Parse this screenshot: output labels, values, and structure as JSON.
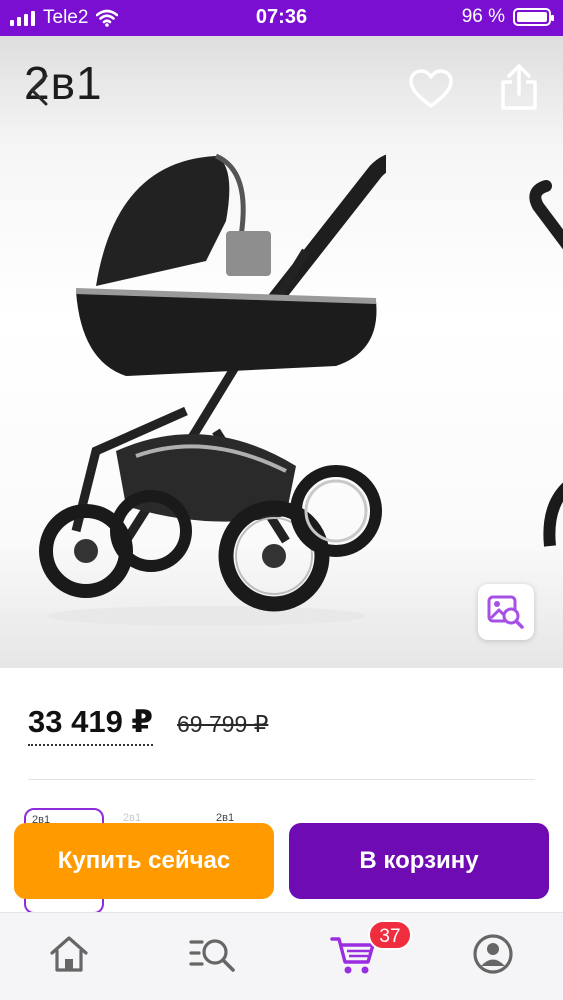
{
  "status_bar": {
    "carrier": "Tele2",
    "time": "07:36",
    "battery_percent": "96 %"
  },
  "gallery": {
    "title": "2в1",
    "image_subject": "stroller"
  },
  "price": {
    "current": "33 419 ₽",
    "old": "69 799 ₽"
  },
  "variants": {
    "items": [
      {
        "label": "2в1",
        "selected": true
      },
      {
        "label": "2в1",
        "selected": false
      },
      {
        "label": "2в1",
        "selected": false
      }
    ]
  },
  "actions": {
    "buy_now": "Купить сейчас",
    "add_to_cart": "В корзину"
  },
  "tabbar": {
    "items": [
      "home-icon",
      "catalog-search-icon",
      "cart-icon",
      "profile-icon"
    ],
    "cart_count": "37"
  },
  "colors": {
    "brand_purple": "#7a0fd1",
    "cart_button": "#6e0bb3",
    "buy_button": "#ff9b00",
    "badge": "#ef2d3e",
    "active_tab": "#9b2de0"
  }
}
